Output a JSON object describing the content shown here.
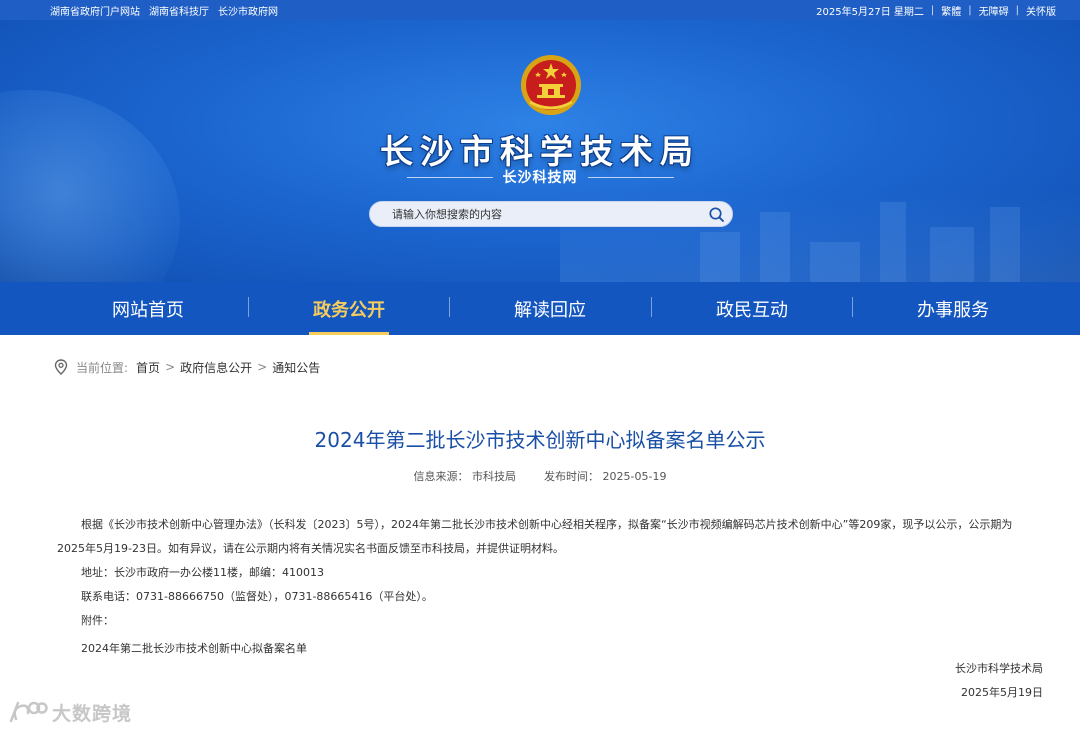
{
  "topbar": {
    "links": [
      "湖南省政府门户网站",
      "湖南省科技厅",
      "长沙市政府网"
    ],
    "date": "2025年5月27日 星期二",
    "traditional": "繁體",
    "accessible": "无障碍",
    "care": "关怀版"
  },
  "header": {
    "title": "长沙市科学技术局",
    "subtitle": "长沙科技网"
  },
  "search": {
    "placeholder": "请输入你想搜索的内容"
  },
  "nav": {
    "items": [
      "网站首页",
      "政务公开",
      "解读回应",
      "政民互动",
      "办事服务"
    ],
    "active_index": 1
  },
  "breadcrumb": {
    "label": "当前位置:",
    "items": [
      "首页",
      "政府信息公开",
      "通知公告"
    ],
    "separator": ">"
  },
  "article": {
    "title": "2024年第二批长沙市技术创新中心拟备案名单公示",
    "source": "信息来源： 市科技局",
    "published": "发布时间： 2025-05-19",
    "para1_line1": "根据《长沙市技术创新中心管理办法》（长科发〔2023〕5号），2024年第二批长沙市技术创新中心经相关程序，拟备案“长沙市视频编解码芯片技术创新中心”等209家，现予以公示，公示期为",
    "para1_line2": "2025年5月19-23日。如有异议，请在公示期内将有关情况实名书面反馈至市科技局，并提供证明材料。",
    "address": "地址：长沙市政府一办公楼11楼，邮编：410013",
    "phone": "联系电话：0731-88666750（监督处），0731-88665416（平台处）。",
    "attachment_label": "附件：",
    "attachment": "2024年第二批长沙市技术创新中心拟备案名单",
    "signer": "长沙市科学技术局",
    "sign_date": "2025年5月19日"
  },
  "watermark": "大数跨境",
  "colors": {
    "topbar": "#1f5fc5",
    "nav": "#1456c0",
    "accent": "#f6cd5c",
    "title_blue": "#1a4fa6"
  }
}
